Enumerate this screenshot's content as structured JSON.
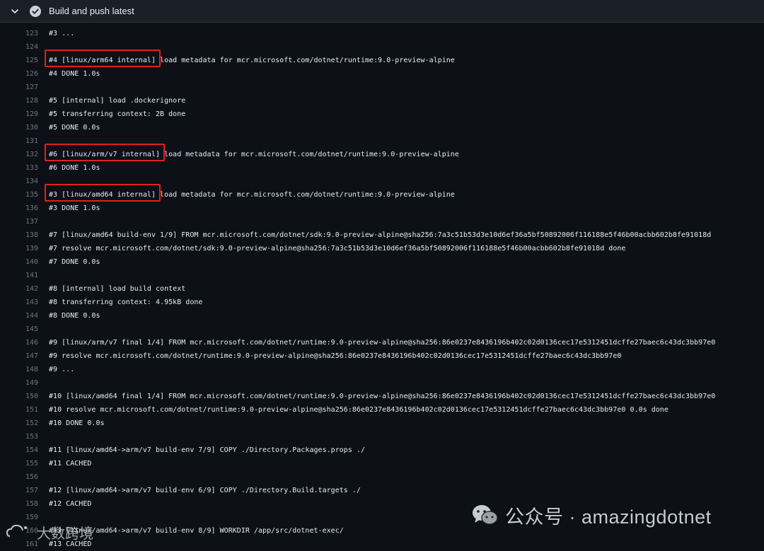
{
  "step": {
    "title": "Build and push latest",
    "status": "success"
  },
  "colors": {
    "background": "#0d1117",
    "header_background": "#1b2028",
    "line_number": "#6e7681",
    "text": "#e6edf3",
    "highlight_box": "#e0201d"
  },
  "log_lines": [
    {
      "n": "",
      "t": ""
    },
    {
      "n": "123",
      "t": "#3 ..."
    },
    {
      "n": "124",
      "t": ""
    },
    {
      "n": "125",
      "t": "#4 [linux/arm64 internal] load metadata for mcr.microsoft.com/dotnet/runtime:9.0-preview-alpine"
    },
    {
      "n": "126",
      "t": "#4 DONE 1.0s"
    },
    {
      "n": "127",
      "t": ""
    },
    {
      "n": "128",
      "t": "#5 [internal] load .dockerignore"
    },
    {
      "n": "129",
      "t": "#5 transferring context: 2B done"
    },
    {
      "n": "130",
      "t": "#5 DONE 0.0s"
    },
    {
      "n": "131",
      "t": ""
    },
    {
      "n": "132",
      "t": "#6 [linux/arm/v7 internal] load metadata for mcr.microsoft.com/dotnet/runtime:9.0-preview-alpine"
    },
    {
      "n": "133",
      "t": "#6 DONE 1.0s"
    },
    {
      "n": "134",
      "t": ""
    },
    {
      "n": "135",
      "t": "#3 [linux/amd64 internal] load metadata for mcr.microsoft.com/dotnet/runtime:9.0-preview-alpine"
    },
    {
      "n": "136",
      "t": "#3 DONE 1.0s"
    },
    {
      "n": "137",
      "t": ""
    },
    {
      "n": "138",
      "t": "#7 [linux/amd64 build-env 1/9] FROM mcr.microsoft.com/dotnet/sdk:9.0-preview-alpine@sha256:7a3c51b53d3e10d6ef36a5bf50892006f116188e5f46b00acbb602b8fe91018d"
    },
    {
      "n": "139",
      "t": "#7 resolve mcr.microsoft.com/dotnet/sdk:9.0-preview-alpine@sha256:7a3c51b53d3e10d6ef36a5bf50892006f116188e5f46b00acbb602b8fe91018d done"
    },
    {
      "n": "140",
      "t": "#7 DONE 0.0s"
    },
    {
      "n": "141",
      "t": ""
    },
    {
      "n": "142",
      "t": "#8 [internal] load build context"
    },
    {
      "n": "143",
      "t": "#8 transferring context: 4.95kB done"
    },
    {
      "n": "144",
      "t": "#8 DONE 0.0s"
    },
    {
      "n": "145",
      "t": ""
    },
    {
      "n": "146",
      "t": "#9 [linux/arm/v7 final 1/4] FROM mcr.microsoft.com/dotnet/runtime:9.0-preview-alpine@sha256:86e0237e8436196b402c02d0136cec17e5312451dcffe27baec6c43dc3bb97e0"
    },
    {
      "n": "147",
      "t": "#9 resolve mcr.microsoft.com/dotnet/runtime:9.0-preview-alpine@sha256:86e0237e8436196b402c02d0136cec17e5312451dcffe27baec6c43dc3bb97e0"
    },
    {
      "n": "148",
      "t": "#9 ..."
    },
    {
      "n": "149",
      "t": ""
    },
    {
      "n": "150",
      "t": "#10 [linux/amd64 final 1/4] FROM mcr.microsoft.com/dotnet/runtime:9.0-preview-alpine@sha256:86e0237e8436196b402c02d0136cec17e5312451dcffe27baec6c43dc3bb97e0"
    },
    {
      "n": "151",
      "t": "#10 resolve mcr.microsoft.com/dotnet/runtime:9.0-preview-alpine@sha256:86e0237e8436196b402c02d0136cec17e5312451dcffe27baec6c43dc3bb97e0 0.0s done"
    },
    {
      "n": "152",
      "t": "#10 DONE 0.0s"
    },
    {
      "n": "153",
      "t": ""
    },
    {
      "n": "154",
      "t": "#11 [linux/amd64->arm/v7 build-env 7/9] COPY ./Directory.Packages.props ./"
    },
    {
      "n": "155",
      "t": "#11 CACHED"
    },
    {
      "n": "156",
      "t": ""
    },
    {
      "n": "157",
      "t": "#12 [linux/amd64->arm/v7 build-env 6/9] COPY ./Directory.Build.targets ./"
    },
    {
      "n": "158",
      "t": "#12 CACHED"
    },
    {
      "n": "159",
      "t": ""
    },
    {
      "n": "160",
      "t": "#13 [linux/amd64->arm/v7 build-env 8/9] WORKDIR /app/src/dotnet-exec/"
    },
    {
      "n": "161",
      "t": "#13 CACHED"
    }
  ],
  "highlights": [
    {
      "line": "125",
      "text": "#4 [linux/arm64 internal]"
    },
    {
      "line": "132",
      "text": "#6 [linux/arm/v7 internal]"
    },
    {
      "line": "135",
      "text": "#3 [linux/amd64 internal]"
    }
  ],
  "watermark": {
    "icon": "wechat-icon",
    "text": "公众号 · amazingdotnet"
  },
  "watermark2": {
    "icon": "cloud-logo-icon",
    "text": "大数跨境"
  }
}
